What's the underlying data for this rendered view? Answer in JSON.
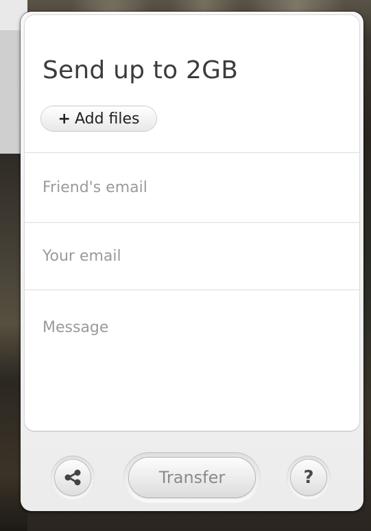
{
  "widget": {
    "title": "Send up to 2GB",
    "add_files": {
      "plus": "+",
      "label": "Add files"
    },
    "fields": {
      "friend_email_placeholder": "Friend's email",
      "your_email_placeholder": "Your email",
      "message_placeholder": "Message"
    },
    "footer": {
      "share_icon": "share-icon",
      "transfer_label": "Transfer",
      "help_label": "?"
    }
  },
  "colors": {
    "title": "#3c3c3c",
    "placeholder": "#9a9a9a",
    "transfer_text": "#8a8a8a",
    "panel": "#f0f0f0"
  }
}
